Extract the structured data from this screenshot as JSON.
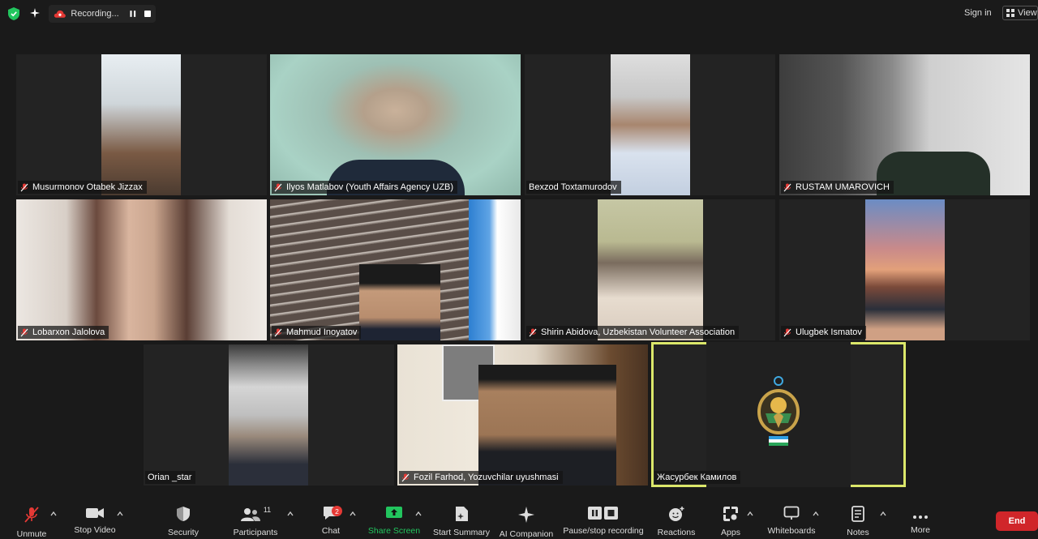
{
  "topbar": {
    "recording_label": "Recording...",
    "sign_in": "Sign in",
    "view": "View"
  },
  "participants": [
    {
      "name": "Musurmonov Otabek Jizzax",
      "muted": true
    },
    {
      "name": "Ilyos Matlabov  (Youth Affairs Agency UZB)",
      "muted": true
    },
    {
      "name": "Bexzod Toxtamurodov",
      "muted": false
    },
    {
      "name": "RUSTAM UMAROVICH",
      "muted": true
    },
    {
      "name": "Lobarxon Jalolova",
      "muted": true
    },
    {
      "name": "Mahmud Inoyatov",
      "muted": true
    },
    {
      "name": "Shirin Abidova, Uzbekistan Volunteer Association",
      "muted": true
    },
    {
      "name": "Ulugbek Ismatov",
      "muted": true
    },
    {
      "name": "Orian _star",
      "muted": false
    },
    {
      "name": "Fozil Farhod, Yozuvchilar uyushmasi",
      "muted": true
    },
    {
      "name": "Жасурбек Камилов",
      "muted": false,
      "active_speaker": true
    }
  ],
  "toolbar": {
    "unmute": "Unmute",
    "stop_video": "Stop Video",
    "security": "Security",
    "participants": "Participants",
    "participants_count": "11",
    "chat": "Chat",
    "chat_badge": "2",
    "share_screen": "Share Screen",
    "start_summary": "Start Summary",
    "ai_companion": "AI Companion",
    "pause_recording": "Pause/stop recording",
    "reactions": "Reactions",
    "apps": "Apps",
    "whiteboards": "Whiteboards",
    "notes": "Notes",
    "more": "More",
    "end": "End"
  },
  "colors": {
    "active_speaker_border": "#dbe76a",
    "share_green": "#22c55e",
    "end_red": "#d0262a",
    "muted_red": "#e53935"
  }
}
